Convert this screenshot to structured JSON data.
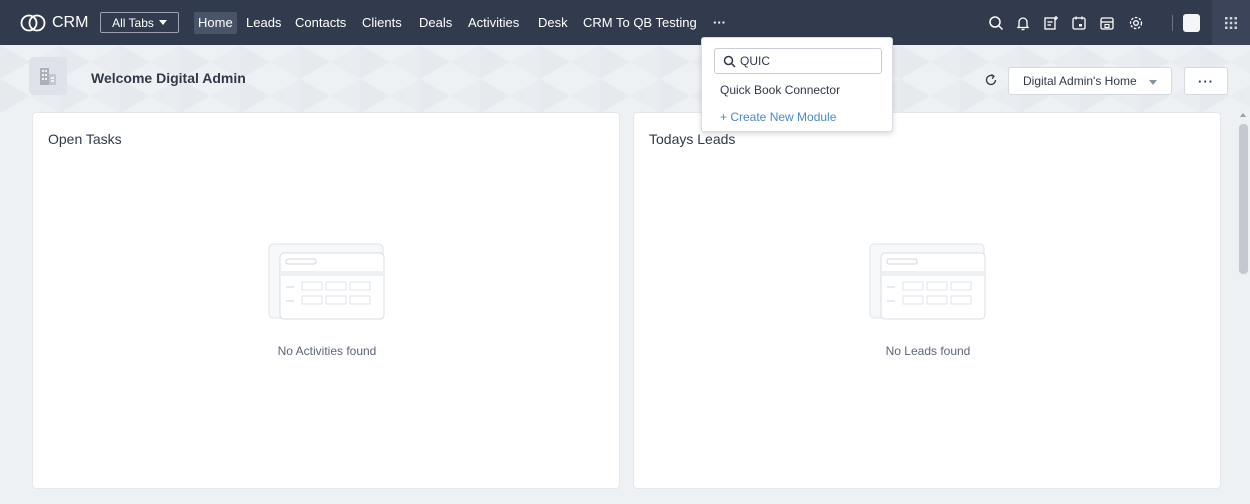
{
  "topbar": {
    "brand": "CRM",
    "all_tabs_label": "All Tabs",
    "nav": [
      {
        "label": "Home",
        "active": true
      },
      {
        "label": "Leads"
      },
      {
        "label": "Contacts"
      },
      {
        "label": "Clients"
      },
      {
        "label": "Deals"
      },
      {
        "label": "Activities"
      },
      {
        "label": "Desk"
      },
      {
        "label": "CRM To QB Testing"
      },
      {
        "label": "···"
      }
    ],
    "icons": [
      "search-icon",
      "bell-icon",
      "calendar-add-icon",
      "calendar-icon",
      "store-icon",
      "gear-icon",
      "avatar",
      "apps-grid-icon"
    ]
  },
  "header": {
    "welcome": "Welcome Digital Admin",
    "home_selector": "Digital Admin's Home",
    "more_label": "···"
  },
  "panels": {
    "open_tasks": {
      "title": "Open Tasks",
      "empty": "No Activities found"
    },
    "todays_leads": {
      "title": "Todays Leads",
      "empty": "No Leads found"
    }
  },
  "dropdown": {
    "search_value": "QUIC",
    "result": "Quick Book Connector",
    "create": "+ Create New Module"
  },
  "colors": {
    "topbar": "#323b4e",
    "accent_link": "#4a89c8",
    "page_bg": "#eef1f4"
  }
}
